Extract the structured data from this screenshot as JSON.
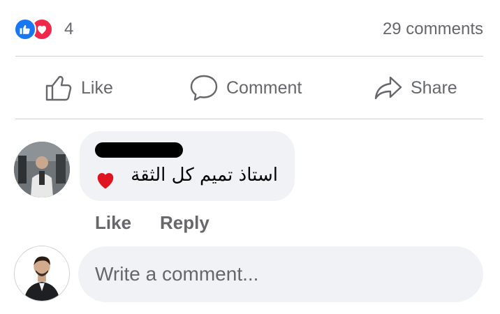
{
  "reactions": {
    "icons": [
      "like-icon",
      "love-icon"
    ],
    "count": "4",
    "comments_label": "29 comments",
    "colors": {
      "like": "#1877f2",
      "love": "#f02849"
    }
  },
  "actions": {
    "like_label": "Like",
    "comment_label": "Comment",
    "share_label": "Share"
  },
  "comment": {
    "text": "استاذ تميم كل الثقة",
    "reaction_emoji": "heart-icon",
    "like_label": "Like",
    "reply_label": "Reply"
  },
  "composer": {
    "placeholder": "Write a comment..."
  },
  "colors": {
    "bubble": "#f0f2f5",
    "secondary_text": "#65676b",
    "divider": "#ced0d4",
    "heart": "#e0141e"
  }
}
